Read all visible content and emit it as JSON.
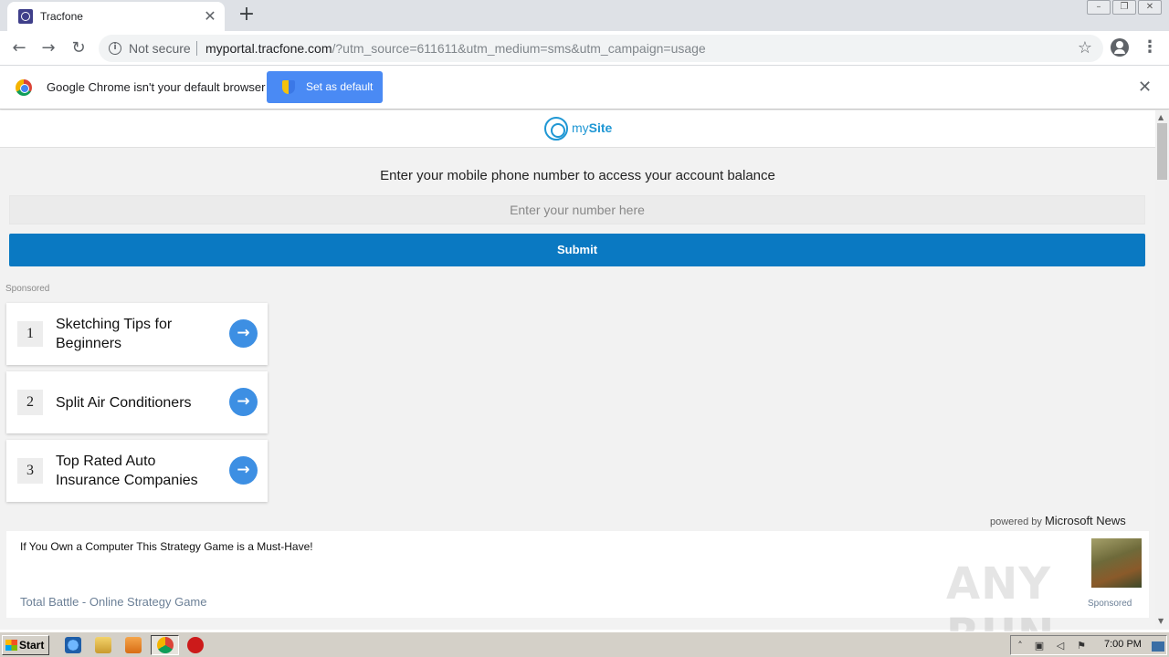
{
  "browser": {
    "tab_title": "Tracfone",
    "url_host": "myportal.tracfone.com",
    "url_rest": "/?utm_source=611611&utm_medium=sms&utm_campaign=usage",
    "security_label": "Not secure",
    "new_tab_glyph": "+",
    "close_glyph": "✕"
  },
  "infobar": {
    "message": "Google Chrome isn't your default browser",
    "button_label": "Set as default"
  },
  "site": {
    "logo_my": "my",
    "logo_site": "Site",
    "prompt": "Enter your mobile phone number to access your account balance",
    "input_placeholder": "Enter your number here",
    "submit_label": "Submit",
    "sponsored_label": "Sponsored"
  },
  "ads": [
    {
      "number": "1",
      "title": "Sketching Tips for Beginners"
    },
    {
      "number": "2",
      "title": "Split Air Conditioners"
    },
    {
      "number": "3",
      "title": "Top Rated Auto Insurance Companies"
    }
  ],
  "news": {
    "powered_by": "powered by",
    "provider": "Microsoft News",
    "headline": "If You Own a Computer This Strategy Game is a Must-Have!",
    "source": "Total Battle - Online Strategy Game",
    "sponsored": "Sponsored"
  },
  "watermark": "ANY RUN",
  "taskbar": {
    "start_label": "Start",
    "clock": "7:00 PM"
  },
  "colors": {
    "submit_blue": "#0a79c2",
    "ad_arrow_blue": "#3d8fe3",
    "logo_blue": "#1f97d4"
  }
}
